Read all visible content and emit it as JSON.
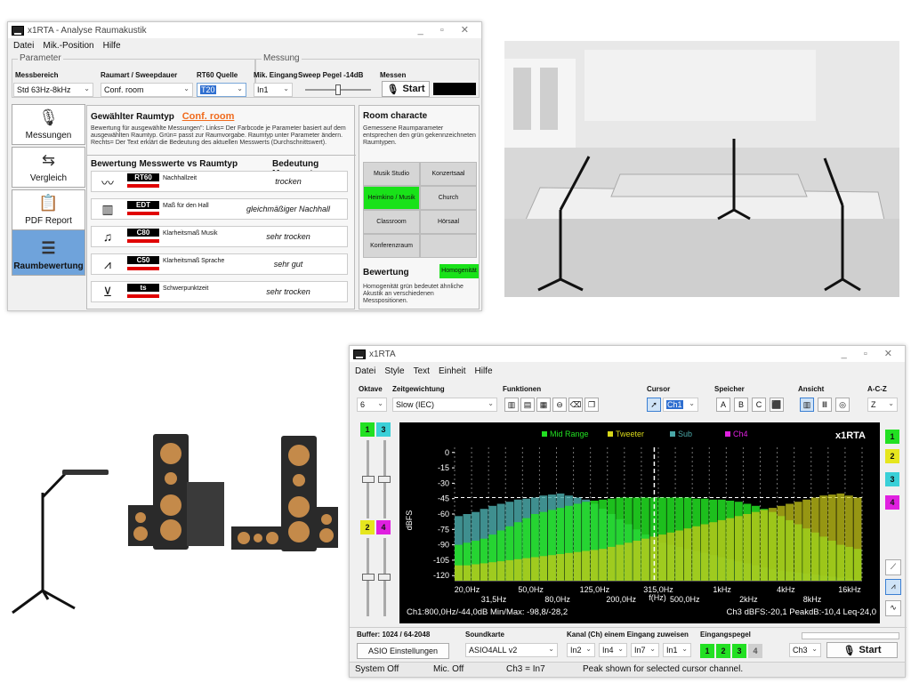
{
  "win1": {
    "title": "x1RTA - Analyse Raumakustik",
    "menu": [
      "Datei",
      "Mik.-Position",
      "Hilfe"
    ],
    "param_group": "Parameter",
    "measure_group": "Messung",
    "labels": {
      "messbereich": "Messbereich",
      "raumart": "Raumart / Sweepdauer",
      "rt60quelle": "RT60 Quelle",
      "mik_eingang": "Mik. Eingang",
      "sweep": "Sweep Pegel -14dB",
      "messen": "Messen"
    },
    "values": {
      "messbereich": "Std 63Hz-8kHz",
      "raumart": "Conf. room",
      "rt60quelle": "T20",
      "mik_eingang": "In1",
      "start": "Start"
    },
    "side": [
      "Messungen",
      "Vergleich",
      "PDF Report",
      "Raumbewertung"
    ],
    "selected_title": "Gewählter Raumtyp",
    "selected_room": "Conf. room",
    "help_text": "Bewertung für ausgewählte Messungen\": Links= Der Farbcode je Parameter basiert auf dem ausgewählten Raumtyp. Grün= passt zur Raumvorgabe. Raumtyp unter Parameter ändern. Rechts= Der Text erklärt die Bedeutung des aktuellen Messwerts (Durchschnittswert).",
    "eval_header": "Bewertung Messwerte vs Raumtyp",
    "meaning_header": "Bedeutung Messwert",
    "rows": [
      {
        "tag": "RT60",
        "desc": "Nachhallzeit",
        "val": "trocken"
      },
      {
        "tag": "EDT",
        "desc": "Maß für den Hall",
        "val": "gleichmäßiger Nachhall"
      },
      {
        "tag": "C80",
        "desc": "Klarheitsmaß Musik",
        "val": "sehr trocken"
      },
      {
        "tag": "C50",
        "desc": "Klarheitsmaß Sprache",
        "val": "sehr gut"
      },
      {
        "tag": "ts",
        "desc": "Schwerpunktzeit",
        "val": "sehr trocken"
      }
    ],
    "room_char_title": "Room characte",
    "room_char_text": "Gemessene Raumparameter entsprechen den grün gekennzeichneten Raumtypen.",
    "room_types": [
      "Musik Studio",
      "Konzertsaal",
      "Heimkino / Musik",
      "Church",
      "Classroom",
      "Hörsaal",
      "Konferenzraum",
      ""
    ],
    "bewertung_title": "Bewertung",
    "bewertung_badge": "Homogenität",
    "bewertung_text": "Homogenität grün bedeutet ähnliche Akustik an verschiedenen Messpositionen."
  },
  "win2": {
    "title": "x1RTA",
    "menu": [
      "Datei",
      "Style",
      "Text",
      "Einheit",
      "Hilfe"
    ],
    "labels": {
      "oktave": "Oktave",
      "zeit": "Zeitgewichtung",
      "funktionen": "Funktionen",
      "cursor": "Cursor",
      "speicher": "Speicher",
      "ansicht": "Ansicht",
      "acz": "A-C-Z"
    },
    "values": {
      "oktave": "6",
      "zeit": "Slow (IEC)",
      "cursor_ch": "Ch1",
      "acz": "Z",
      "speicher": [
        "A",
        "B",
        "C"
      ]
    },
    "channels_left_top": [
      "1",
      "3"
    ],
    "channels_left_bottom": [
      "2",
      "4"
    ],
    "channels_right": [
      "1",
      "2",
      "3",
      "4"
    ],
    "chart_brand": "x1RTA",
    "legend": [
      {
        "name": "Mid Range",
        "color": "#22e022"
      },
      {
        "name": "Tweeter",
        "color": "#d8d81a"
      },
      {
        "name": "Sub",
        "color": "#4aa8a8"
      },
      {
        "name": "Ch4",
        "color": "#e020e0"
      }
    ],
    "ylabel": "dBFS",
    "xlabel": "f(Hz)",
    "yticks": [
      "0",
      "-15",
      "-30",
      "-45",
      "-60",
      "-75",
      "-90",
      "-105",
      "-120"
    ],
    "xticks_top": [
      "20,0Hz",
      "50,0Hz",
      "125,0Hz",
      "315,0Hz",
      "1kHz",
      "4kHz",
      "16kHz"
    ],
    "xticks_bottom": [
      "31,5Hz",
      "80,0Hz",
      "200,0Hz",
      "500,0Hz",
      "2kHz",
      "8kHz"
    ],
    "readout_left": "Ch1:800,0Hz/-44,0dB Min/Max: -98,8/-28,2",
    "readout_right": "Ch3 dBFS:-20,1 PeakdB:-10,4 Leq-24,0",
    "buffer": "Buffer: 1024 / 64-2048",
    "asio_btn": "ASIO Einstellungen",
    "soundkarte": "Soundkarte",
    "soundkarte_val": "ASIO4ALL v2",
    "kanal": "Kanal (Ch) einem Eingang zuweisen",
    "kanal_vals": [
      "In2",
      "In4",
      "In7",
      "In1"
    ],
    "eingangspegel": "Eingangspegel",
    "pegel": [
      "1",
      "2",
      "3",
      "4"
    ],
    "ch_select": "Ch3",
    "start": "Start",
    "status": [
      "System Off",
      "Mic. Off",
      "Ch3 = In7",
      "Peak shown for selected cursor channel."
    ]
  },
  "chart_data": {
    "type": "bar",
    "xlabel": "f(Hz)",
    "ylabel": "dBFS",
    "ylim": [
      -125,
      5
    ],
    "series": [
      {
        "name": "Sub",
        "values": [
          -62,
          -60,
          -58,
          -55,
          -52,
          -50,
          -48,
          -46,
          -45,
          -44,
          -42,
          -41,
          -40,
          -42,
          -44,
          -46,
          -50,
          -55,
          -60,
          -65,
          -70,
          -75,
          -80,
          -85,
          -88,
          -90,
          -92,
          -94,
          -96,
          -98,
          -100,
          -102,
          -104,
          -106,
          -108,
          -110,
          -112,
          -114,
          -115,
          -116,
          -117,
          -118,
          -119,
          -120,
          -121,
          -122,
          -123,
          -124
        ]
      },
      {
        "name": "Mid Range",
        "values": [
          -90,
          -88,
          -86,
          -84,
          -80,
          -76,
          -72,
          -68,
          -64,
          -60,
          -58,
          -56,
          -54,
          -52,
          -50,
          -48,
          -47,
          -46,
          -45,
          -44,
          -44,
          -44,
          -44,
          -44,
          -44,
          -44,
          -44,
          -44,
          -45,
          -45,
          -46,
          -46,
          -47,
          -48,
          -50,
          -52,
          -55,
          -58,
          -62,
          -66,
          -70,
          -74,
          -78,
          -82,
          -86,
          -90,
          -92,
          -94
        ]
      },
      {
        "name": "Tweeter",
        "values": [
          -110,
          -110,
          -109,
          -108,
          -107,
          -106,
          -105,
          -104,
          -103,
          -102,
          -101,
          -100,
          -99,
          -98,
          -97,
          -96,
          -95,
          -94,
          -92,
          -90,
          -88,
          -86,
          -84,
          -82,
          -80,
          -78,
          -76,
          -74,
          -72,
          -70,
          -68,
          -66,
          -64,
          -62,
          -60,
          -58,
          -56,
          -54,
          -52,
          -50,
          -48,
          -46,
          -44,
          -42,
          -41,
          -40,
          -42,
          -44
        ]
      }
    ]
  }
}
